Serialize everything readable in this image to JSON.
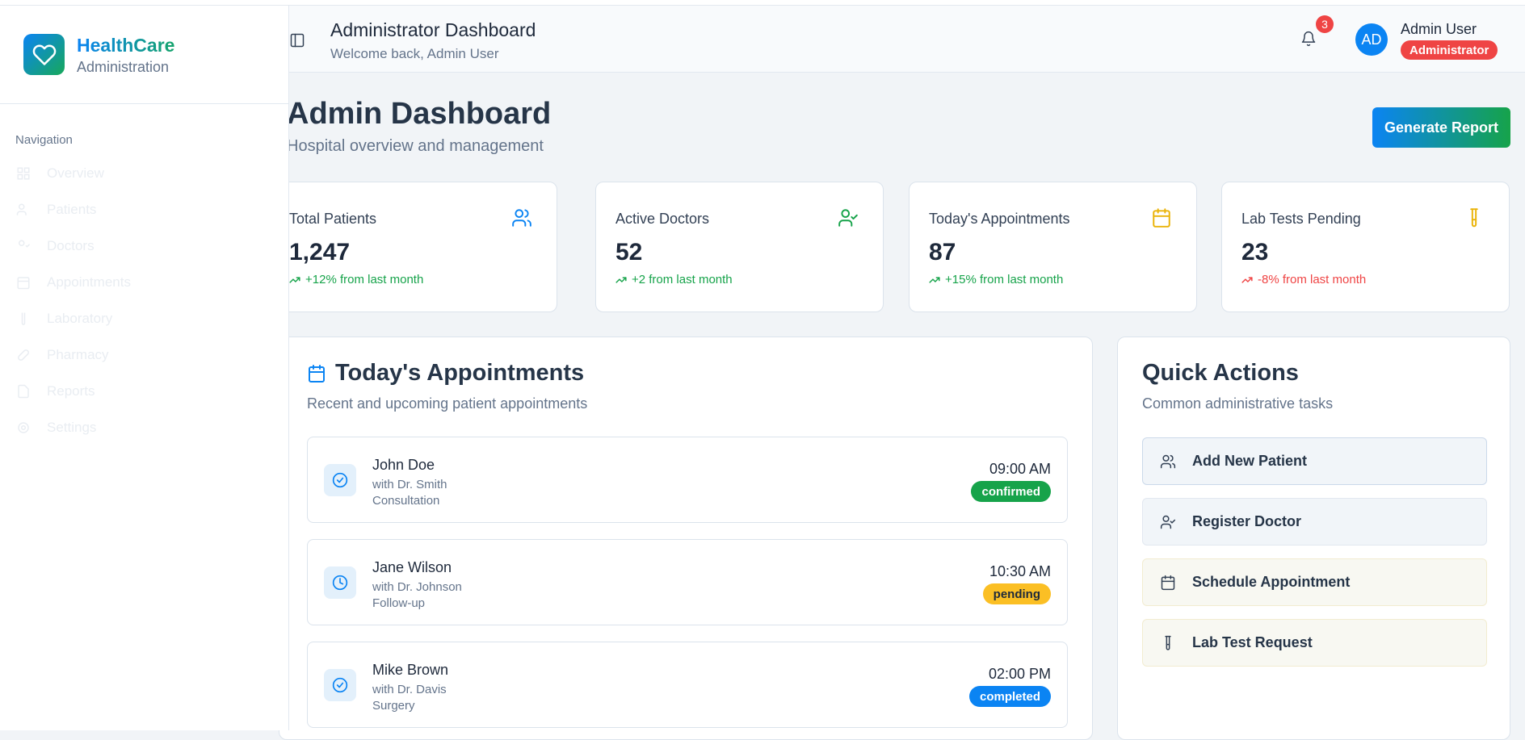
{
  "brand": {
    "name": "HealthCare",
    "subtitle": "Administration"
  },
  "sidebar": {
    "section_title": "Navigation",
    "items": [
      {
        "label": "Overview",
        "icon": "grid-icon"
      },
      {
        "label": "Patients",
        "icon": "users-icon"
      },
      {
        "label": "Doctors",
        "icon": "user-check-icon"
      },
      {
        "label": "Appointments",
        "icon": "calendar-icon"
      },
      {
        "label": "Laboratory",
        "icon": "test-tube-icon"
      },
      {
        "label": "Pharmacy",
        "icon": "pill-icon"
      },
      {
        "label": "Reports",
        "icon": "file-icon"
      },
      {
        "label": "Settings",
        "icon": "gear-icon"
      }
    ]
  },
  "header": {
    "title": "Administrator Dashboard",
    "subtitle": "Welcome back, Admin User",
    "notification_count": "3",
    "avatar_initials": "AD",
    "user_name": "Admin User",
    "user_role": "Administrator"
  },
  "page": {
    "title": "Admin Dashboard",
    "subtitle": "Hospital overview and management",
    "generate_button": "Generate Report"
  },
  "stats": [
    {
      "label": "Total Patients",
      "value": "1,247",
      "trend": "+12% from last month",
      "direction": "up",
      "icon": "users-icon",
      "icon_color": "#0b84f3"
    },
    {
      "label": "Active Doctors",
      "value": "52",
      "trend": "+2 from last month",
      "direction": "up",
      "icon": "user-check-icon",
      "icon_color": "#16a34a"
    },
    {
      "label": "Today's Appointments",
      "value": "87",
      "trend": "+15% from last month",
      "direction": "up",
      "icon": "calendar-icon",
      "icon_color": "#eab308"
    },
    {
      "label": "Lab Tests Pending",
      "value": "23",
      "trend": "-8% from last month",
      "direction": "down",
      "icon": "test-tube-icon",
      "icon_color": "#eab308"
    }
  ],
  "appointments_card": {
    "title": "Today's Appointments",
    "subtitle": "Recent and upcoming patient appointments",
    "items": [
      {
        "name": "John Doe",
        "doctor": "with Dr. Smith",
        "type": "Consultation",
        "time": "09:00 AM",
        "status": "confirmed",
        "icon": "check-circle-icon"
      },
      {
        "name": "Jane Wilson",
        "doctor": "with Dr. Johnson",
        "type": "Follow-up",
        "time": "10:30 AM",
        "status": "pending",
        "icon": "clock-icon"
      },
      {
        "name": "Mike Brown",
        "doctor": "with Dr. Davis",
        "type": "Surgery",
        "time": "02:00 PM",
        "status": "completed",
        "icon": "check-circle-icon"
      }
    ]
  },
  "quick_actions": {
    "title": "Quick Actions",
    "subtitle": "Common administrative tasks",
    "items": [
      {
        "label": "Add New Patient",
        "icon": "users-icon"
      },
      {
        "label": "Register Doctor",
        "icon": "user-check-icon"
      },
      {
        "label": "Schedule Appointment",
        "icon": "calendar-icon"
      },
      {
        "label": "Lab Test Request",
        "icon": "test-tube-icon"
      }
    ]
  },
  "colors": {
    "primary": "#0b84f3",
    "success": "#16a34a",
    "warning": "#fbbf24",
    "danger": "#ef4444"
  }
}
